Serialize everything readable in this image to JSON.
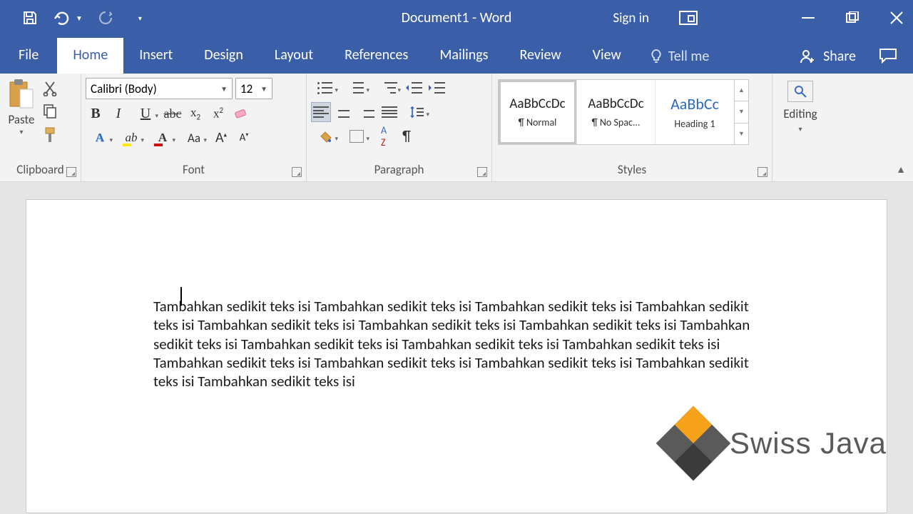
{
  "titlebar": {
    "document": "Document1",
    "app": "Word",
    "separator": "  -  ",
    "sign_in": "Sign in"
  },
  "tabs": {
    "file": "File",
    "home": "Home",
    "insert": "Insert",
    "design": "Design",
    "layout": "Layout",
    "references": "References",
    "mailings": "Mailings",
    "review": "Review",
    "view": "View",
    "tell_me": "Tell me",
    "share": "Share"
  },
  "ribbon": {
    "clipboard": {
      "label": "Clipboard",
      "paste": "Paste"
    },
    "font": {
      "label": "Font",
      "name": "Calibri (Body)",
      "size": "12",
      "case": "Aa"
    },
    "paragraph": {
      "label": "Paragraph"
    },
    "styles": {
      "label": "Styles",
      "preview": "AaBbCcDc",
      "preview_heading": "AaBbCc",
      "normal": "¶ Normal",
      "nospace": "¶ No Spac...",
      "heading1": "Heading 1"
    },
    "editing": {
      "label": "Editing"
    }
  },
  "document": {
    "body": "Tambahkan sedikit teks isi Tambahkan sedikit teks isi Tambahkan sedikit teks isi Tambahkan sedikit teks isi Tambahkan sedikit teks isi Tambahkan sedikit teks isi Tambahkan sedikit teks isi Tambahkan sedikit teks isi Tambahkan sedikit teks isi Tambahkan sedikit teks isi Tambahkan sedikit teks isi Tambahkan sedikit teks isi Tambahkan sedikit teks isi Tambahkan sedikit teks isi Tambahkan sedikit teks isi Tambahkan sedikit teks isi"
  },
  "watermark": {
    "text": "Swiss Java"
  }
}
